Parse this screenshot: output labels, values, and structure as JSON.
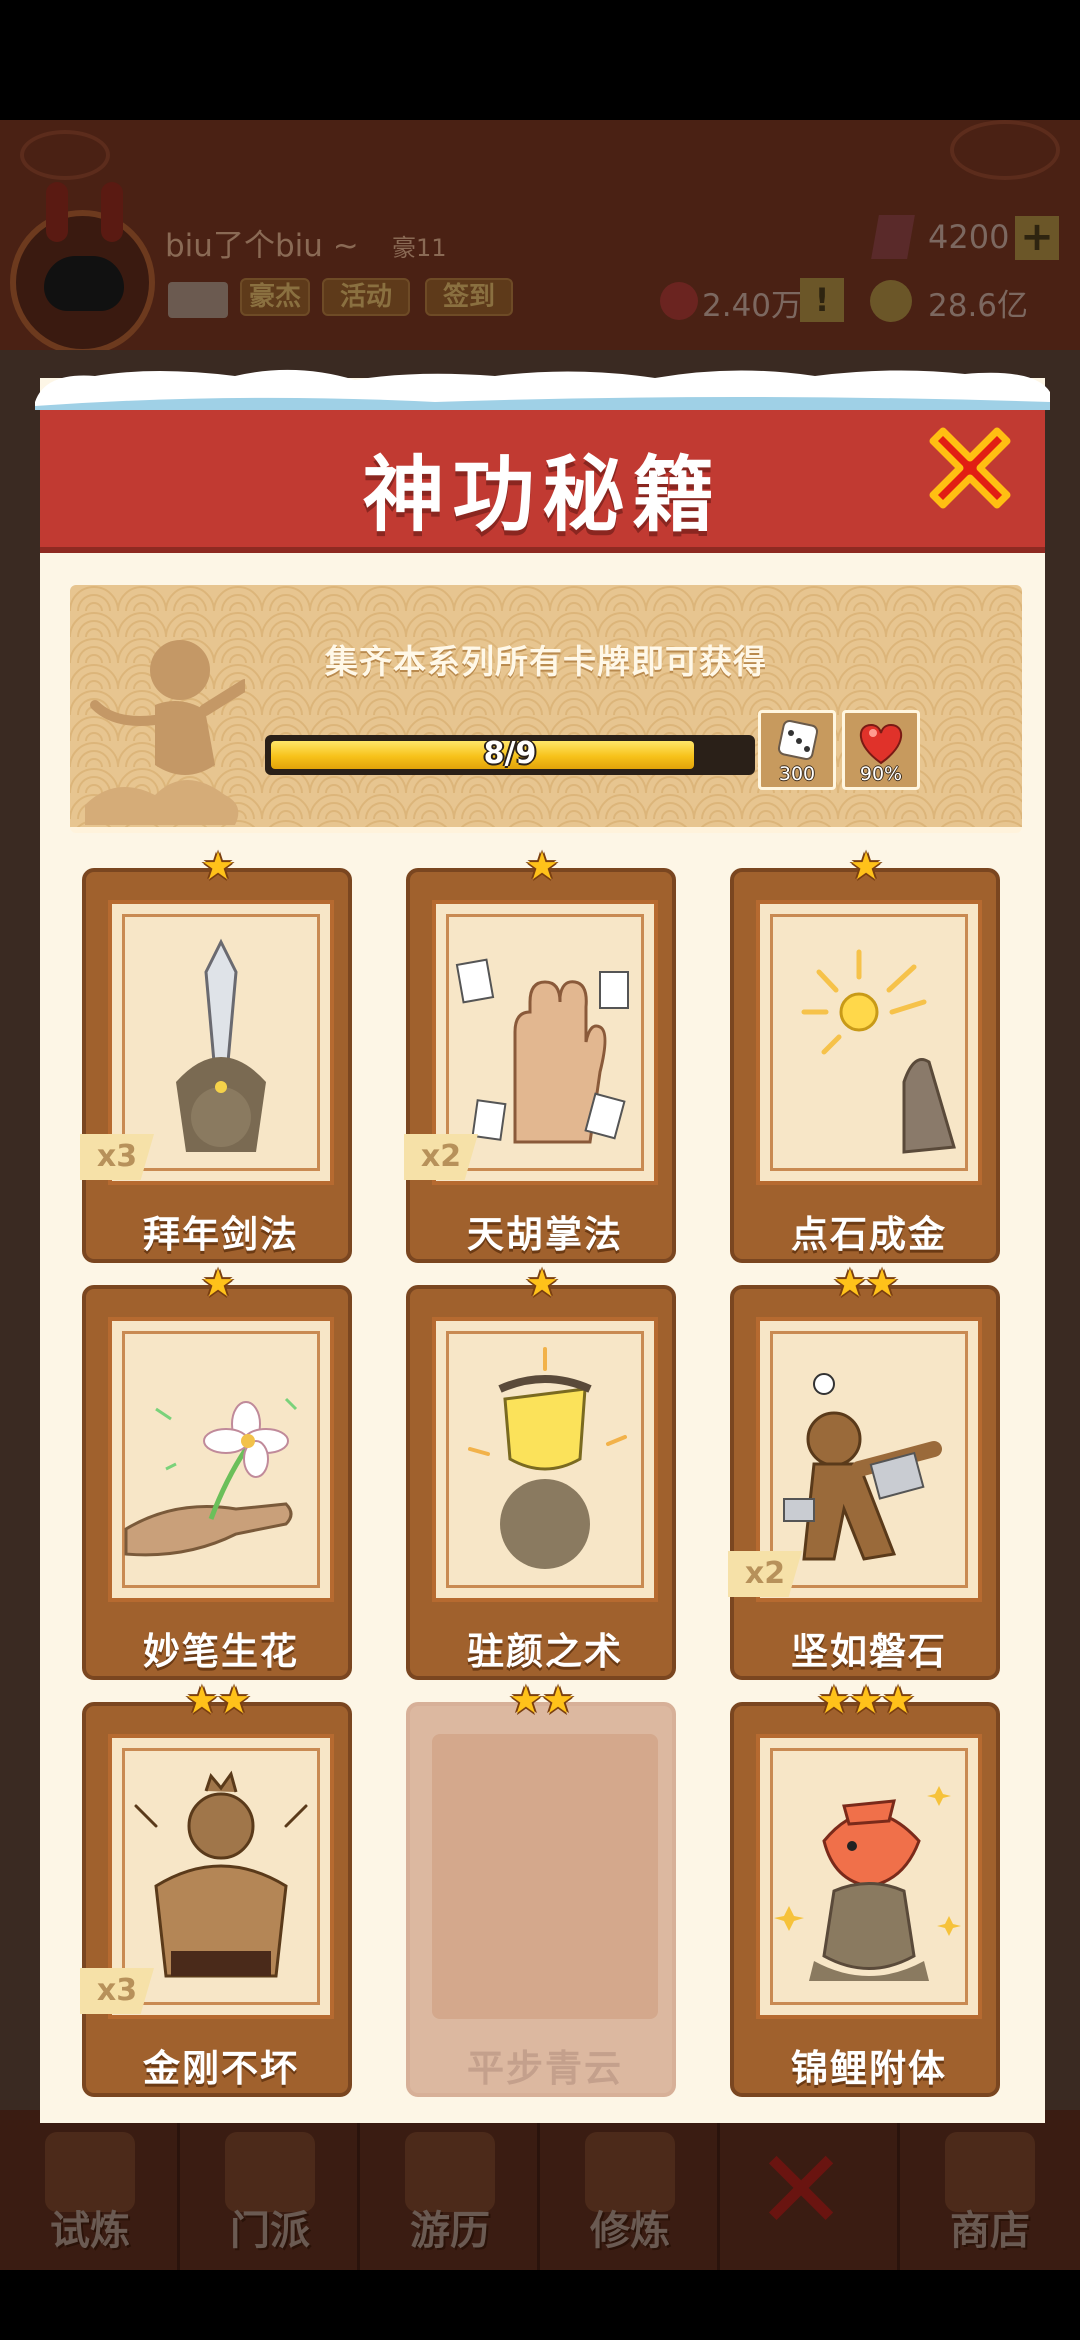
{
  "hud": {
    "username": "biu了个biu ~",
    "level": "豪11",
    "buttons": [
      "豪杰",
      "活动",
      "签到"
    ],
    "gems": "4200",
    "plus_label": "+",
    "bounty": "2.40万",
    "warn_label": "!",
    "coins": "28.6亿"
  },
  "nav": {
    "items": [
      "试炼",
      "门派",
      "游历",
      "修炼",
      "",
      "商店"
    ]
  },
  "modal": {
    "title": "神功秘籍",
    "banner_text": "集齐本系列所有卡牌即可获得",
    "progress": {
      "current": 8,
      "total": 9,
      "label": "8/9"
    },
    "rewards": [
      {
        "icon": "dice-icon",
        "value": "300"
      },
      {
        "icon": "heart-icon",
        "value": "90%"
      }
    ],
    "cards": [
      {
        "name": "拜年剑法",
        "stars": "★",
        "count": "x3",
        "art": "sword"
      },
      {
        "name": "天胡掌法",
        "stars": "★",
        "count": "x2",
        "art": "palm"
      },
      {
        "name": "点石成金",
        "stars": "★",
        "count": "",
        "art": "gold"
      },
      {
        "name": "妙笔生花",
        "stars": "★",
        "count": "",
        "art": "flower"
      },
      {
        "name": "驻颜之术",
        "stars": "★",
        "count": "",
        "art": "mask"
      },
      {
        "name": "坚如磐石",
        "stars": "★★",
        "count": "x2",
        "art": "rock"
      },
      {
        "name": "金刚不坏",
        "stars": "★★",
        "count": "x3",
        "art": "muscle"
      },
      {
        "name": "平步青云",
        "stars": "★★",
        "count": "",
        "art": "locked"
      },
      {
        "name": "锦鲤附体",
        "stars": "★★★",
        "count": "",
        "art": "koi"
      }
    ]
  },
  "colors": {
    "header_red": "#c13a32",
    "card_brown": "#a0612d",
    "star_gold": "#ffc21a",
    "progress_yellow": "#f7c21a"
  }
}
